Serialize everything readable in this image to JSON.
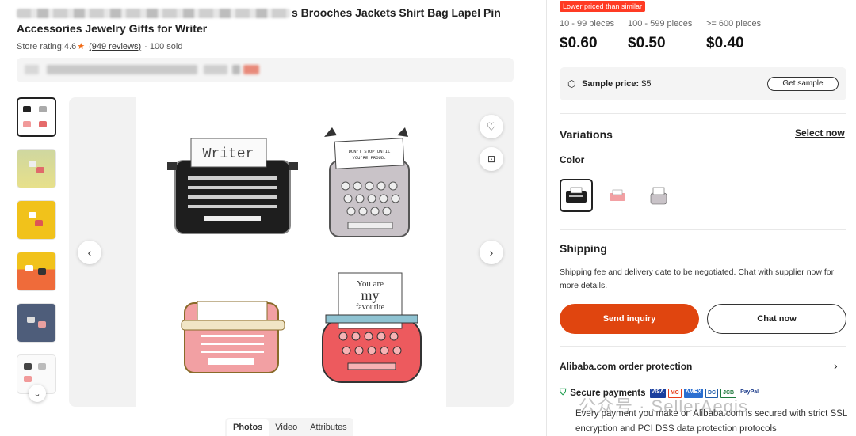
{
  "product": {
    "title_visible": "s Brooches Jackets Shirt Bag Lapel Pin",
    "title_line2": "Accessories Jewelry Gifts for Writer",
    "rating_label": "Store rating:",
    "rating_value": "4.6",
    "reviews": "(949 reviews)",
    "sold": "· 100 sold"
  },
  "gallery": {
    "tabs": [
      "Photos",
      "Video",
      "Attributes"
    ],
    "active_tab": "Photos",
    "image_text": {
      "writer": "Writer",
      "dont_stop_1": "DON'T STOP UNTIL",
      "dont_stop_2": "YOU'RE PROUD.",
      "you_are": "You are",
      "my": "my",
      "favourite": "favourite"
    }
  },
  "pricing": {
    "badge": "Lower priced than similar",
    "tiers": [
      {
        "range": "10 - 99 pieces",
        "price": "$0.60"
      },
      {
        "range": "100 - 599 pieces",
        "price": "$0.50"
      },
      {
        "range": ">= 600 pieces",
        "price": "$0.40"
      }
    ],
    "sample_label": "Sample price:",
    "sample_value": " $5",
    "get_sample": "Get sample"
  },
  "variations": {
    "title": "Variations",
    "select_now": "Select now",
    "color_label": "Color"
  },
  "shipping": {
    "title": "Shipping",
    "text": "Shipping fee and delivery date to be negotiated. Chat with supplier now for more details."
  },
  "actions": {
    "send_inquiry": "Send inquiry",
    "chat_now": "Chat now"
  },
  "protection": {
    "title": "Alibaba.com order protection",
    "secure_title": "Secure payments",
    "pay_logos": [
      "VISA",
      "MC",
      "AMEX",
      "DC",
      "JCB",
      "PayPal"
    ],
    "secure_desc": "Every payment you make on Alibaba.com is secured with strict SSL encryption and PCI DSS data protection protocols"
  },
  "watermark": "公众号 · SellerAegis",
  "colors": {
    "accent": "#e0450f",
    "badge": "#ff3b24",
    "star": "#f26b16"
  }
}
